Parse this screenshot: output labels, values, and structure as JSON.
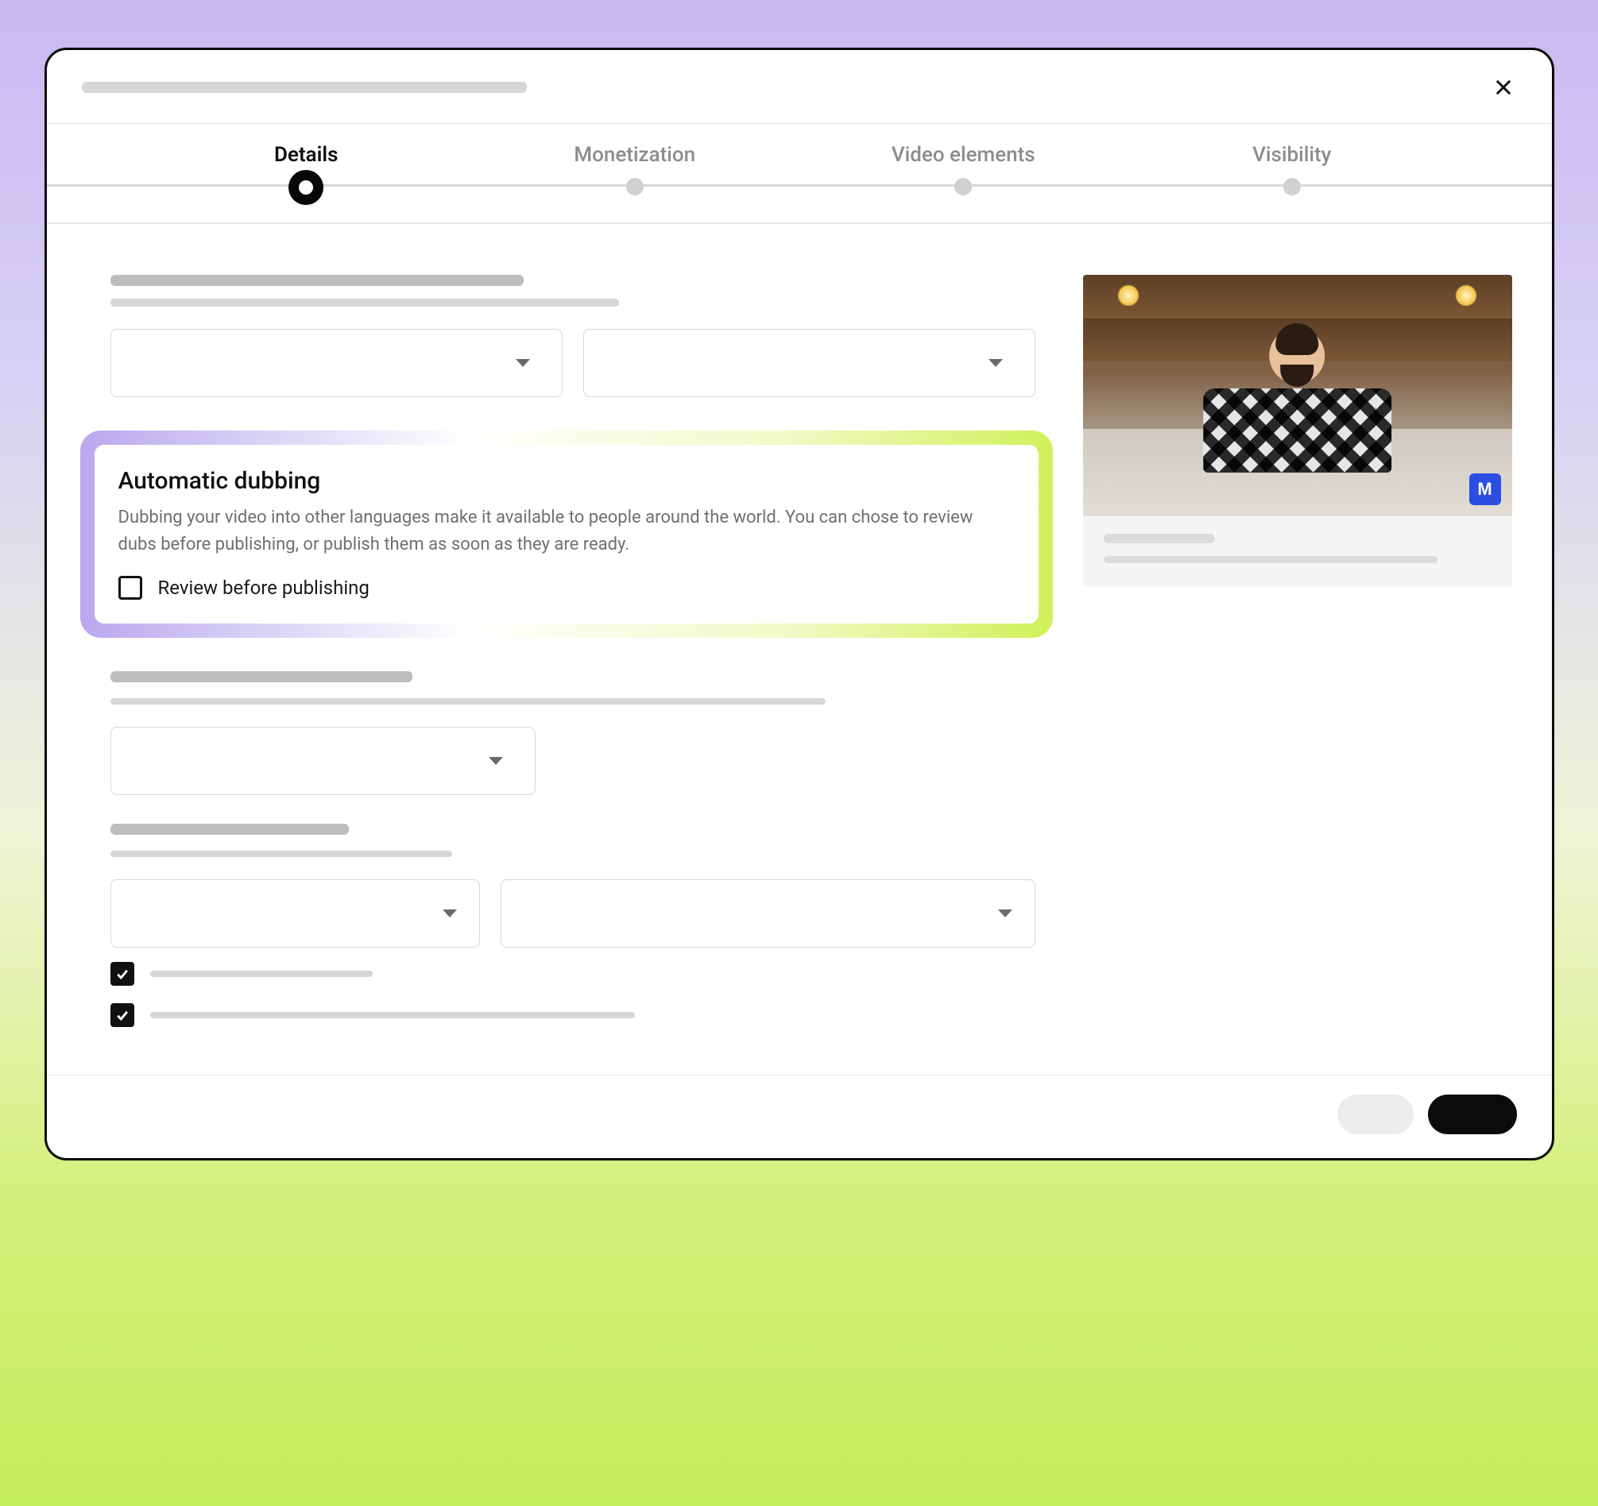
{
  "stepper": {
    "steps": [
      {
        "label": "Details",
        "active": true
      },
      {
        "label": "Monetization",
        "active": false
      },
      {
        "label": "Video elements",
        "active": false
      },
      {
        "label": "Visibility",
        "active": false
      }
    ]
  },
  "dubbing": {
    "title": "Automatic dubbing",
    "description": "Dubbing your video into other languages make it available to people around the world. You can chose to review dubs before publishing, or publish them as soon as they are ready.",
    "checkbox_label": "Review before publishing",
    "checked": false
  },
  "bottom_checks": [
    {
      "checked": true
    },
    {
      "checked": true
    }
  ],
  "thumbnail": {
    "badge": "M"
  }
}
